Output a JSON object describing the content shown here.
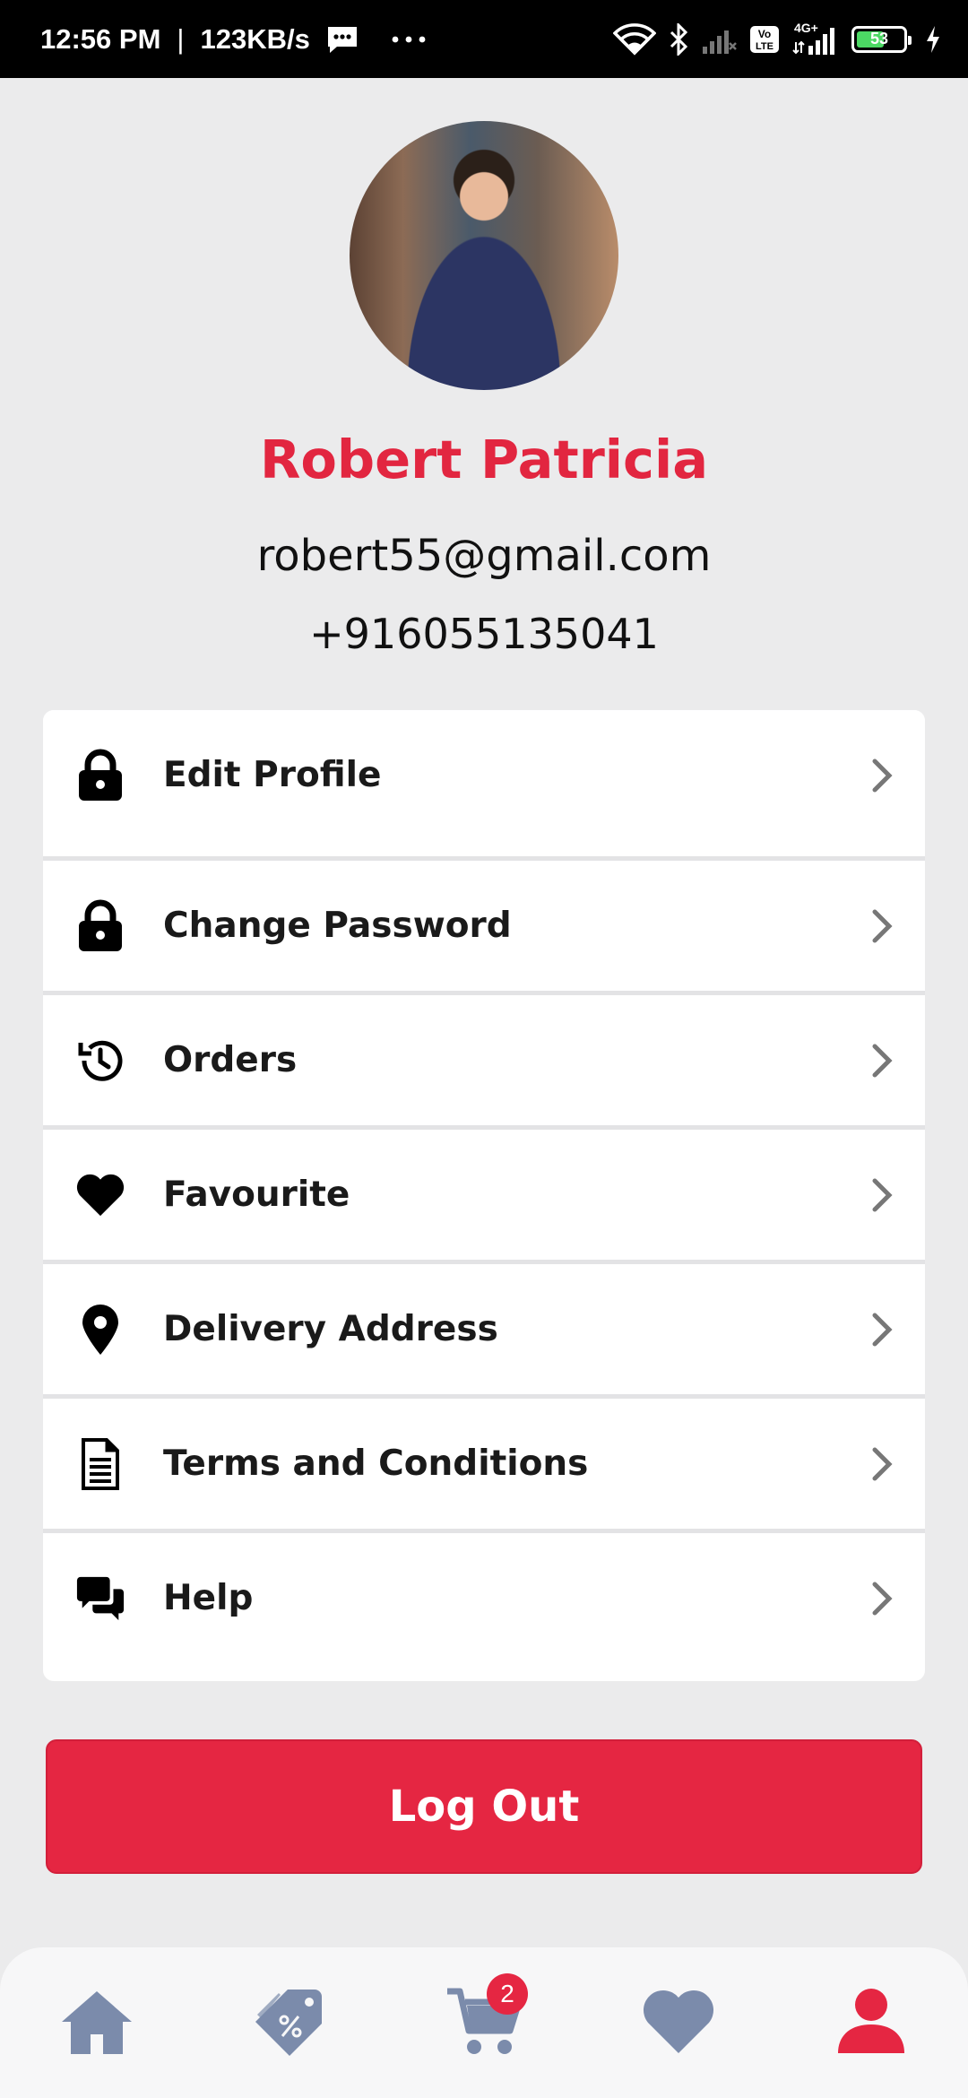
{
  "status_bar": {
    "time": "12:56 PM",
    "speed": "123KB/s",
    "battery_level": "53",
    "network_label": "4G+",
    "icons": [
      "message-icon",
      "more-dots-icon",
      "wifi-icon",
      "bluetooth-icon",
      "signal-icon",
      "volte-icon",
      "signal-4g-icon",
      "battery-icon",
      "charging-icon"
    ]
  },
  "profile": {
    "name": "Robert Patricia",
    "email": "robert55@gmail.com",
    "phone": "+916055135041"
  },
  "menu": {
    "items": [
      {
        "label": "Edit Profile",
        "icon": "lock-icon"
      },
      {
        "label": "Change Password",
        "icon": "lock-icon"
      },
      {
        "label": "Orders",
        "icon": "history-icon"
      },
      {
        "label": "Favourite",
        "icon": "heart-icon"
      },
      {
        "label": "Delivery Address",
        "icon": "location-pin-icon"
      },
      {
        "label": "Terms and Conditions",
        "icon": "document-icon"
      },
      {
        "label": "Help",
        "icon": "chat-icon"
      }
    ]
  },
  "logout_label": "Log Out",
  "bottom_nav": {
    "items": [
      "home-icon",
      "offers-tag-icon",
      "cart-icon",
      "heart-icon",
      "user-icon"
    ],
    "cart_badge": "2",
    "active": "user-icon"
  },
  "colors": {
    "accent": "#e52642",
    "nav_inactive": "#7b8bab",
    "background": "#ebebec"
  }
}
